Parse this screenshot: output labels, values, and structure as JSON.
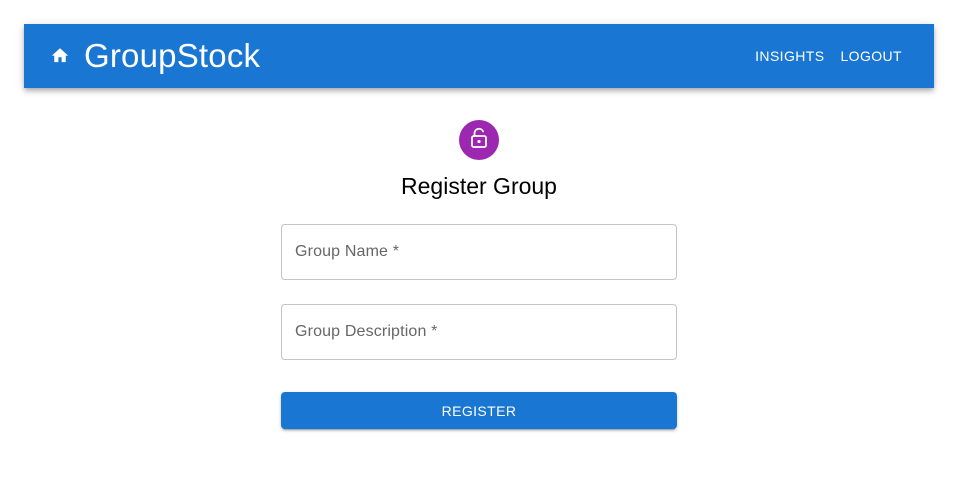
{
  "colors": {
    "primary": "#1976d2",
    "avatar": "#9c27b0",
    "field_border": "#c4c4c4",
    "label_text": "#666666"
  },
  "appbar": {
    "home_icon": "home-icon",
    "brand": "GroupStock",
    "nav": [
      {
        "label": "INSIGHTS"
      },
      {
        "label": "LOGOUT"
      }
    ]
  },
  "form": {
    "avatar_icon": "lock-open-icon",
    "title": "Register Group",
    "fields": [
      {
        "label": "Group Name *",
        "value": ""
      },
      {
        "label": "Group Description *",
        "value": ""
      }
    ],
    "submit_label": "REGISTER"
  }
}
